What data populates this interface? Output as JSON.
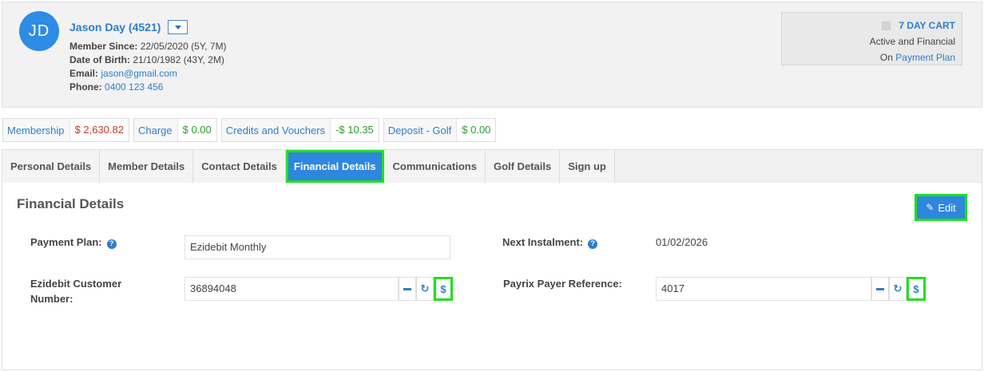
{
  "member": {
    "initials": "JD",
    "name": "Jason Day (4521)",
    "member_since_label": "Member Since:",
    "member_since": "22/05/2020 (5Y, 7M)",
    "dob_label": "Date of Birth:",
    "dob": "21/10/1982 (43Y, 2M)",
    "email_label": "Email:",
    "email": "jason@gmail.com",
    "phone_label": "Phone:",
    "phone": "0400 123 456"
  },
  "status": {
    "title": "7 DAY CART",
    "line1": "Active and Financial",
    "on_label": "On",
    "plan_link": "Payment Plan"
  },
  "balances": [
    {
      "name": "Membership",
      "value": "$ 2,630.82",
      "tone": "neg"
    },
    {
      "name": "Charge",
      "value": "$ 0.00",
      "tone": "pos"
    },
    {
      "name": "Credits and Vouchers",
      "value": "-$ 10.35",
      "tone": "pos"
    },
    {
      "name": "Deposit - Golf",
      "value": "$ 0.00",
      "tone": "pos"
    }
  ],
  "tabs": [
    {
      "label": "Personal Details"
    },
    {
      "label": "Member Details"
    },
    {
      "label": "Contact Details"
    },
    {
      "label": "Financial Details",
      "active": true
    },
    {
      "label": "Communications"
    },
    {
      "label": "Golf Details"
    },
    {
      "label": "Sign up"
    }
  ],
  "financial": {
    "section_title": "Financial Details",
    "edit_label": "Edit",
    "payment_plan_label": "Payment Plan:",
    "payment_plan_value": "Ezidebit Monthly",
    "next_instalment_label": "Next Instalment:",
    "next_instalment_value": "01/02/2026",
    "ezidebit_label_1": "Ezidebit Customer",
    "ezidebit_label_2": "Number:",
    "ezidebit_value": "36894048",
    "payrix_label": "Payrix Payer Reference:",
    "payrix_value": "4017"
  },
  "icons": {
    "help": "?",
    "refresh": "↻",
    "dollar": "$",
    "pencil": "✎"
  },
  "colors": {
    "accent": "#2e86de",
    "link": "#2f7dcc",
    "highlight": "#1fe01f",
    "negative": "#c0392b",
    "positive": "#2a9d2a"
  }
}
